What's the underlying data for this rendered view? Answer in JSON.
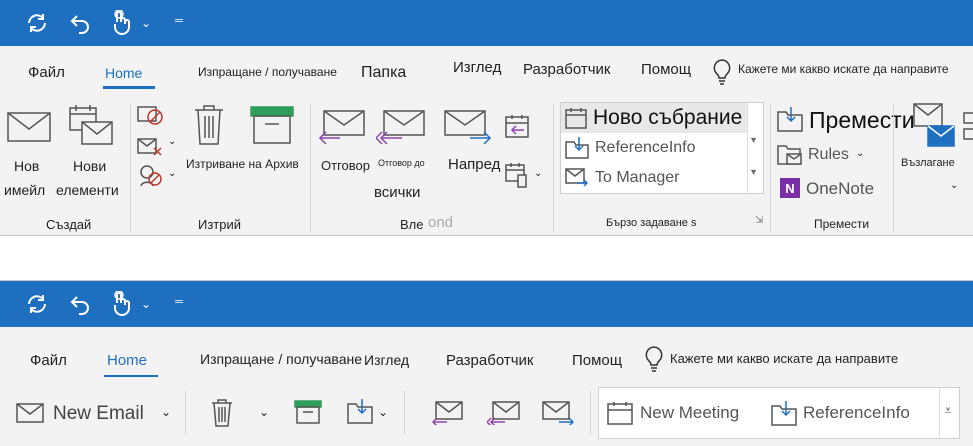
{
  "top": {
    "tabs": [
      "Файл",
      "Home",
      "Изпращане / получаване",
      "Папка",
      "Изглед",
      "Разработчик",
      "Помощ"
    ],
    "tell_me": "Кажете ми какво искате да направите",
    "new_email": [
      "Нов",
      "имейл"
    ],
    "new_items": [
      "Нови",
      "елементи"
    ],
    "delete_archive": "Изтриване на Архив",
    "reply": "Отговор",
    "reply_all_small": "Отговор до",
    "reply_all_2": "всички",
    "forward": "Напред",
    "quick_steps": [
      "Ново събрание",
      "ReferenceInfo",
      "To Manager"
    ],
    "move": "Премести",
    "rules": "Rules",
    "onenote": "OneNote",
    "assign": "Възлагане",
    "groups": {
      "create": "Създай",
      "delete": "Изтрий",
      "respond": "Вле",
      "respond_ghost": "ond",
      "quick_steps": "Бързо задаване s",
      "move": "Премести"
    }
  },
  "bottom": {
    "tabs": [
      "Файл",
      "Home",
      "Изпращане / получаване",
      "Изглед",
      "Разработчик",
      "Помощ"
    ],
    "tell_me": "Кажете ми какво искате да направите",
    "new_email": "New Email",
    "quick_steps": [
      "New Meeting",
      "ReferenceInfo"
    ]
  }
}
